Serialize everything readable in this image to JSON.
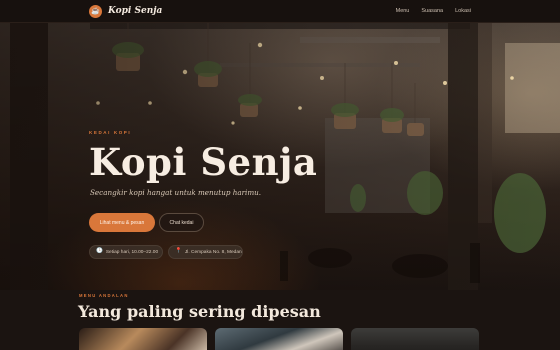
{
  "nav": {
    "logo_glyph": "☕",
    "brand": "Kopi Senja",
    "links": [
      "Menu",
      "Suasana",
      "Lokasi"
    ]
  },
  "hero": {
    "eyebrow": "KEDAI KOPI",
    "title": "Kopi Senja",
    "tagline": "Secangkir kopi hangat untuk menutup harimu.",
    "primary_button": "Lihat menu & pesan",
    "secondary_button": "Chat kedai",
    "hours": "Setiap hari, 10.00–22.00",
    "address": "Jl. Cempaka No. 8, Medan"
  },
  "menu_section": {
    "eyebrow": "MENU ANDALAN",
    "title": "Yang paling sering dipesan"
  },
  "icons": {
    "clock": "clock-icon",
    "pin": "map-pin-icon",
    "logo": "coffee-cup-icon"
  },
  "colors": {
    "accent": "#d9773a",
    "background": "#1b1411",
    "text": "#f3e9dd"
  }
}
